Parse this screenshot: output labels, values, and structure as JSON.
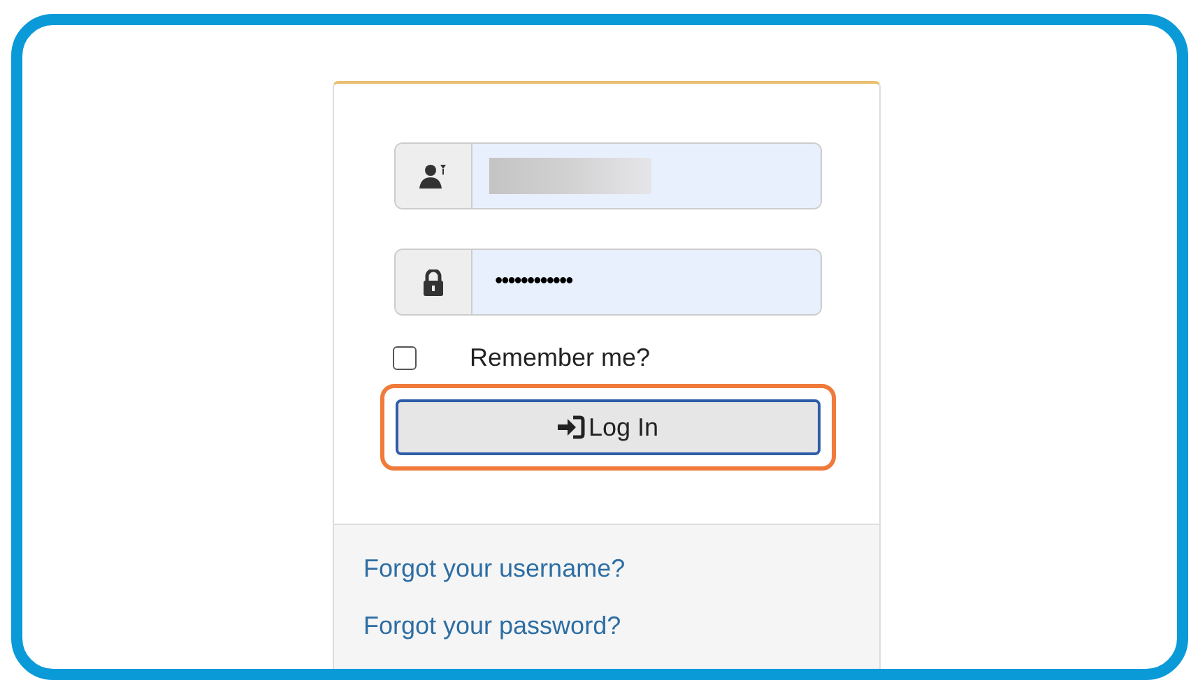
{
  "login_form": {
    "username": {
      "blurred": true
    },
    "password": {
      "value": "••••••••••••"
    },
    "remember_me": {
      "label": "Remember me?",
      "checked": false
    },
    "login_button": {
      "label": "Log In",
      "highlighted": true
    }
  },
  "links": [
    {
      "label": "Forgot your username?"
    },
    {
      "label": "Forgot your password?"
    }
  ]
}
